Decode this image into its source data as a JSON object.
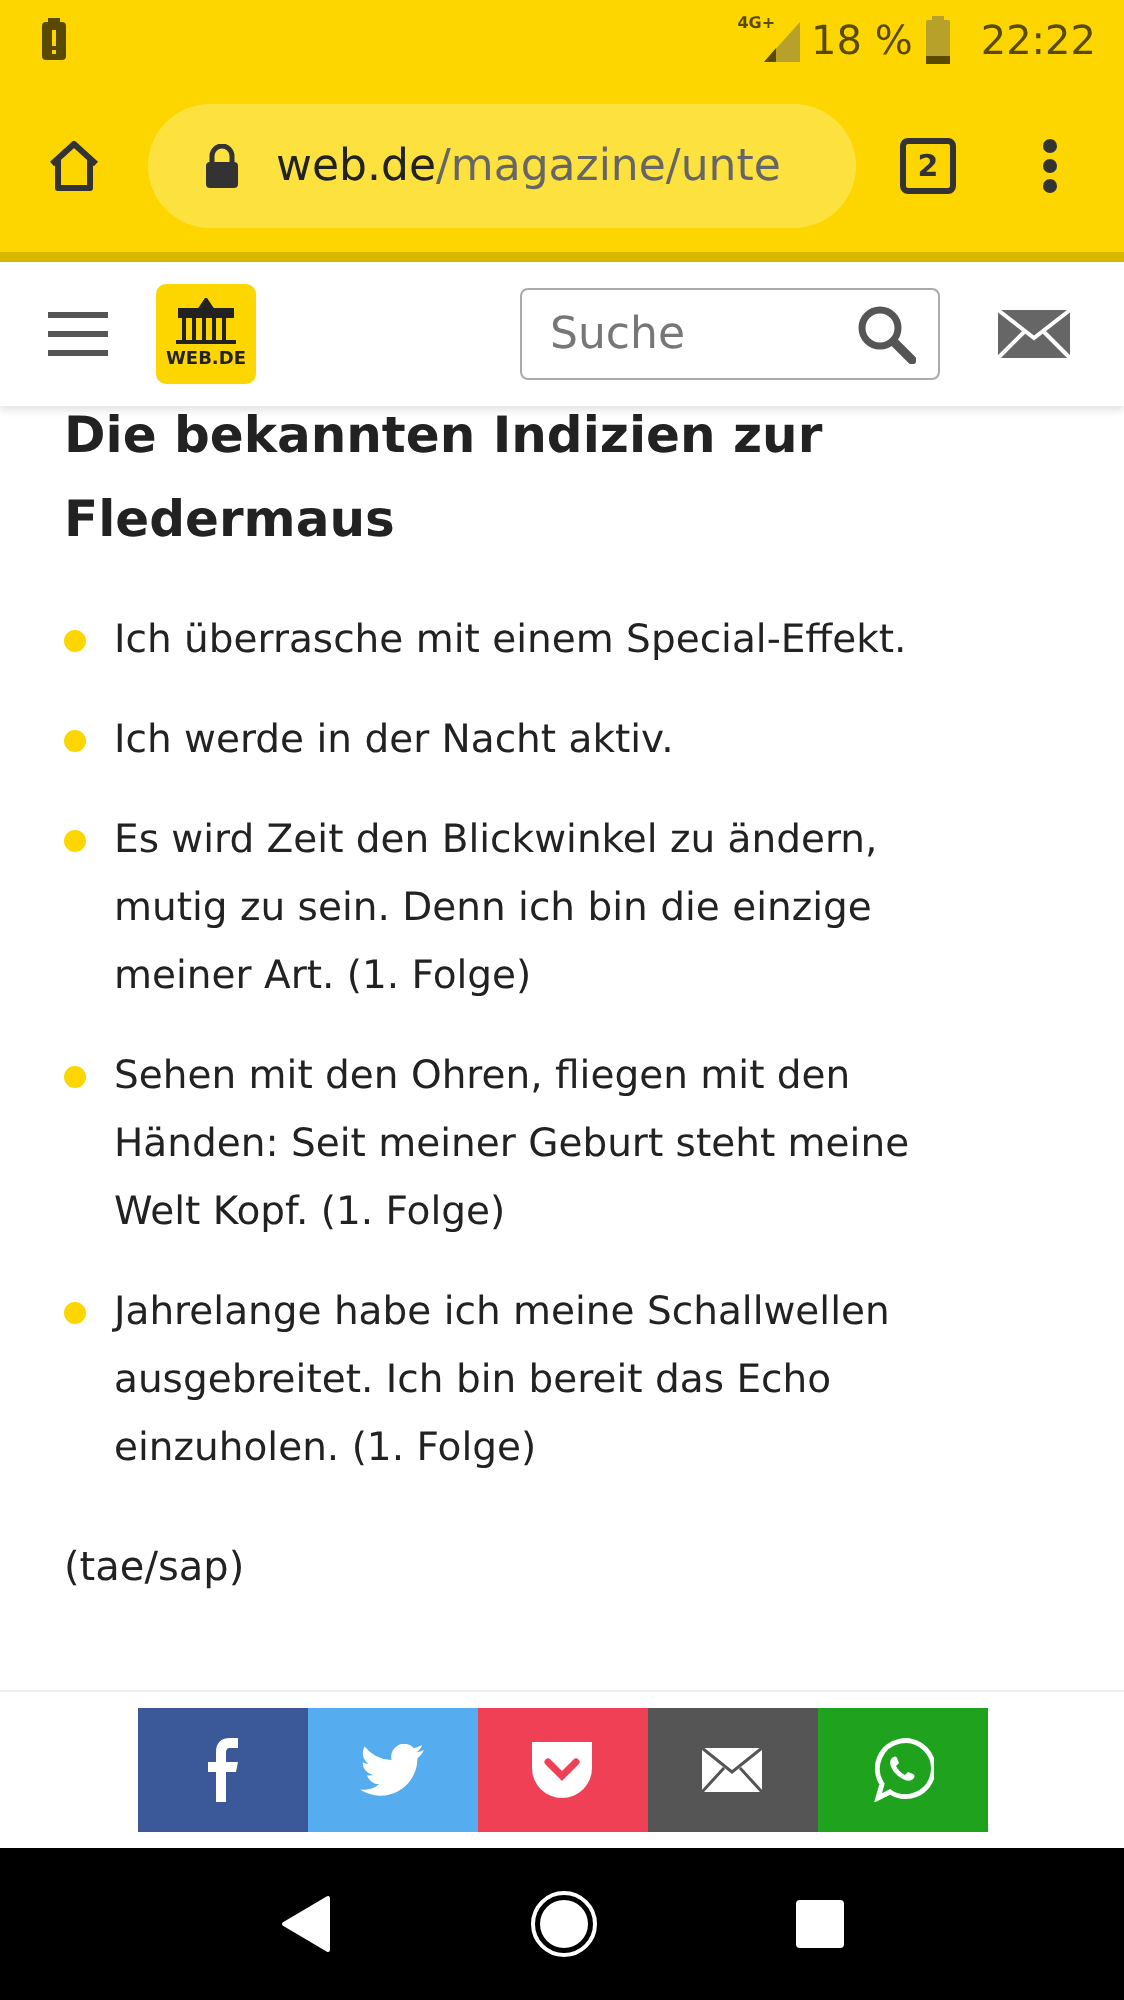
{
  "status_bar": {
    "network": "4G+",
    "battery": "18 %",
    "time": "22:22"
  },
  "browser": {
    "url_host": "web.de",
    "url_path": "/magazine/unte",
    "tab_count": "2"
  },
  "site_header": {
    "logo_text": "WEB.DE",
    "search": {
      "placeholder": "Suche"
    }
  },
  "article": {
    "heading": "Die bekannten Indizien zur Fledermaus",
    "bullets": [
      "Ich überrasche mit einem Special-Effekt.",
      "Ich werde in der Nacht aktiv.",
      "Es wird Zeit den Blickwinkel zu ändern, mutig zu sein. Denn ich bin die einzige meiner Art. (1. Folge)",
      "Sehen mit den Ohren, fliegen mit den Händen: Seit meiner Geburt steht meine Welt Kopf. (1. Folge)",
      "Jahrelange habe ich meine Schallwellen ausgebreitet. Ich bin bereit das Echo einzuholen. (1. Folge)"
    ],
    "credit": "(tae/sap)"
  },
  "share_bar": [
    {
      "kind": "facebook",
      "color": "#3b5998"
    },
    {
      "kind": "twitter",
      "color": "#55acee"
    },
    {
      "kind": "pocket",
      "color": "#ef4056"
    },
    {
      "kind": "email",
      "color": "#555555"
    },
    {
      "kind": "whatsapp",
      "color": "#1fa31f"
    }
  ]
}
